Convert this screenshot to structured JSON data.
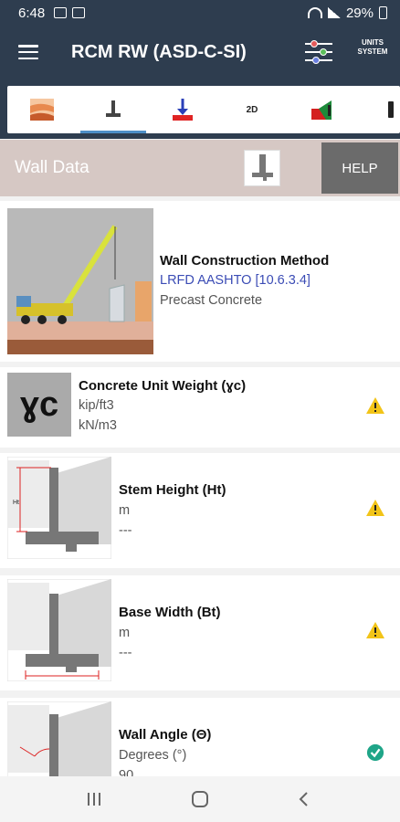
{
  "status_bar": {
    "time": "6:48",
    "battery": "29%"
  },
  "app_bar": {
    "title": "RCM RW (ASD-C-SI)",
    "units_line1": "UNITS",
    "units_line2": "SYSTEM"
  },
  "tabs": {
    "items": [
      {
        "icon": "soil-layers-icon"
      },
      {
        "icon": "wall-section-icon"
      },
      {
        "icon": "load-arrow-icon"
      },
      {
        "label": "2D"
      },
      {
        "icon": "wall-graph-icon"
      },
      {
        "icon": "more-icon"
      }
    ]
  },
  "section": {
    "title": "Wall Data",
    "help_label": "HELP"
  },
  "cards": {
    "construction": {
      "label": "Wall Construction Method",
      "line1": "LRFD AASHTO [10.6.3.4]",
      "line2": "Precast Concrete"
    },
    "unit_weight": {
      "label": "Concrete Unit Weight (ɣc)",
      "line1": "kip/ft3",
      "line2": "kN/m3",
      "symbol": "ɣc",
      "status": "warning"
    },
    "stem_height": {
      "label": "Stem Height (Ht)",
      "line1": "m",
      "line2": "---",
      "status": "warning",
      "dim_label": "Ht"
    },
    "base_width": {
      "label": "Base Width (Bt)",
      "line1": "m",
      "line2": "---",
      "status": "warning"
    },
    "wall_angle": {
      "label": "Wall Angle (Θ)",
      "line1": "Degrees (°)",
      "line2": "90",
      "status": "ok"
    }
  },
  "colors": {
    "appbar": "#2e3d4f",
    "section_header": "#d6c8c4",
    "help": "#6b6b6b",
    "link": "#3b4cb5",
    "warning": "#f2c418",
    "ok": "#1fa588",
    "tab_active": "#4e8fc7"
  }
}
